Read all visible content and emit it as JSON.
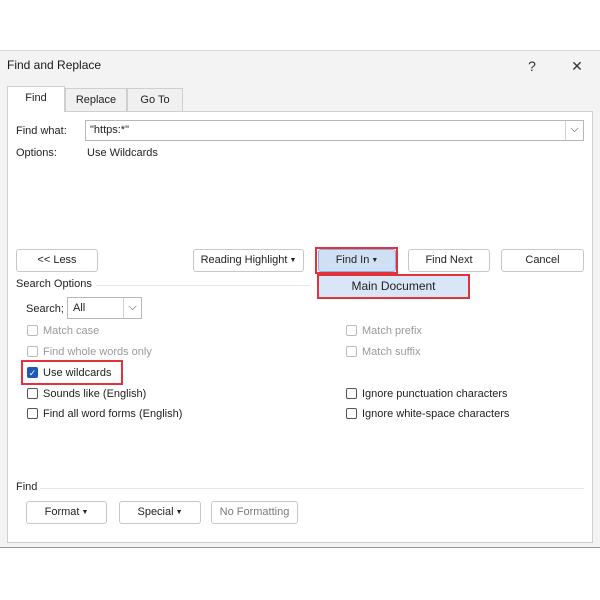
{
  "dialog": {
    "title": "Find and Replace",
    "help_glyph": "?",
    "close_glyph": "✕"
  },
  "tabs": [
    {
      "label": "Find",
      "active": true
    },
    {
      "label": "Replace",
      "active": false
    },
    {
      "label": "Go To",
      "active": false
    }
  ],
  "find_what": {
    "label": "Find what:",
    "value": "\"https:*\"",
    "dropdown_glyph": "⌵"
  },
  "options": {
    "label": "Options:",
    "value": "Use Wildcards"
  },
  "buttons": {
    "less": "<< Less",
    "reading_highlight": "Reading Highlight",
    "find_in": "Find In",
    "find_next": "Find Next",
    "cancel": "Cancel"
  },
  "find_in_menu": {
    "items": [
      "Main Document"
    ]
  },
  "search_options": {
    "heading": "Search Options",
    "search_label": "Search;",
    "search_value": "All",
    "checkboxes_left": [
      {
        "label": "Match case",
        "checked": false,
        "enabled": false
      },
      {
        "label": "Find whole words only",
        "checked": false,
        "enabled": false
      },
      {
        "label": "Use wildcards",
        "checked": true,
        "enabled": true
      },
      {
        "label": "Sounds like (English)",
        "checked": false,
        "enabled": true
      },
      {
        "label": "Find all word forms (English)",
        "checked": false,
        "enabled": true
      }
    ],
    "checkboxes_right": [
      {
        "label": "Match prefix",
        "checked": false,
        "enabled": false
      },
      {
        "label": "Match suffix",
        "checked": false,
        "enabled": false
      },
      {
        "label": "Ignore punctuation characters",
        "checked": false,
        "enabled": true
      },
      {
        "label": "Ignore white-space characters",
        "checked": false,
        "enabled": true
      }
    ]
  },
  "find_section": {
    "heading": "Find",
    "format": "Format",
    "special": "Special",
    "no_formatting": "No Formatting"
  },
  "icons": {
    "checkmark": "✓",
    "dropdown_caret": "▼",
    "select_chevron": "⌵"
  },
  "colors": {
    "highlight_red": "#e0333b",
    "accent_blue": "#1e5bb8",
    "menu_highlight": "#d9e6f7"
  }
}
